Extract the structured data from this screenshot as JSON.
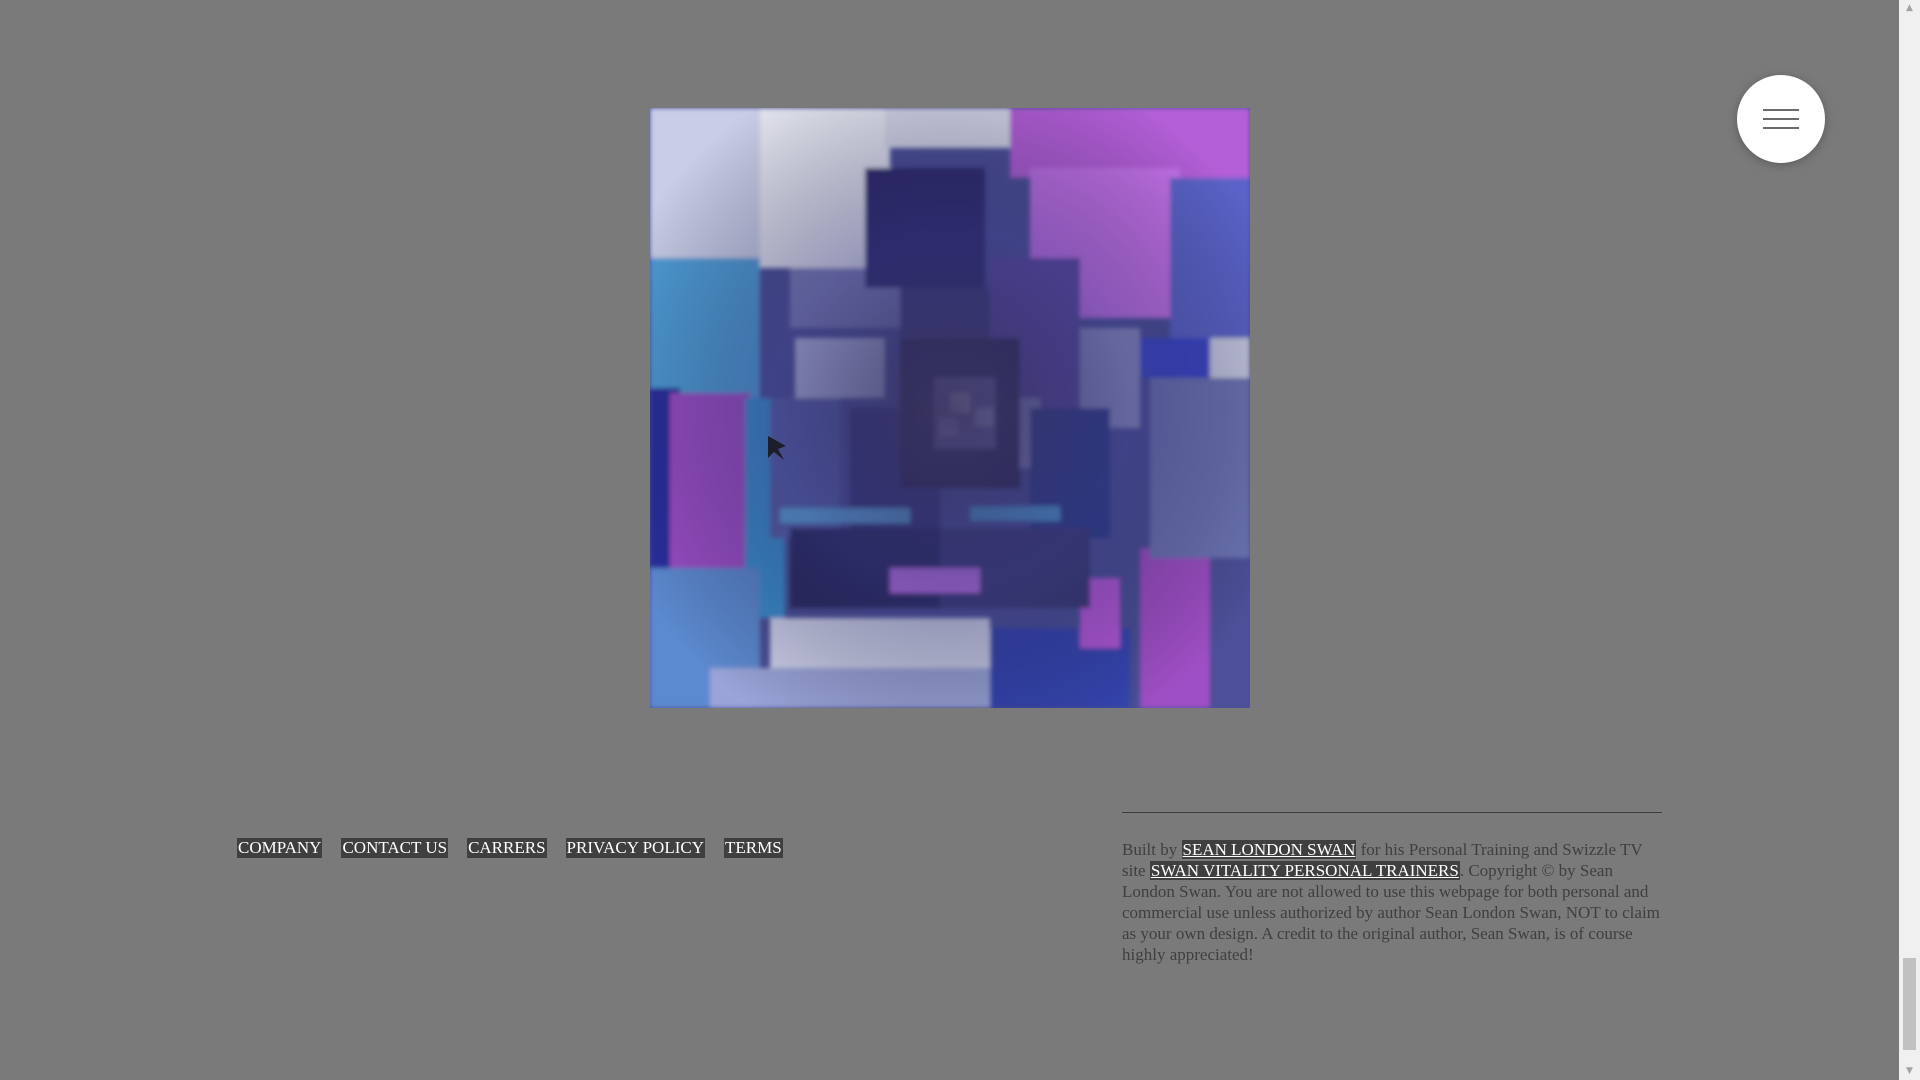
{
  "hero": {
    "image_name": "abstract-cube-tunnel-artwork"
  },
  "menu": {
    "icon": "hamburger-menu-icon"
  },
  "footer_nav": {
    "items": [
      {
        "label": "COMPANY"
      },
      {
        "label": "CONTACT US"
      },
      {
        "label": "CARRERS"
      },
      {
        "label": "PRIVACY POLICY"
      },
      {
        "label": "TERMS"
      }
    ]
  },
  "credits": {
    "prefix": "Built by ",
    "author_link": "SEAN LONDON SWAN",
    "middle": " for his Personal Training and Swizzle TV site ",
    "site_link": "SWAN VITALITY PERSONAL TRAINERS",
    "suffix": ". Copyright © by Sean London Swan. You are not allowed to use this webpage for both personal and commercial use unless authorized by author Sean London Swan, NOT to claim as your own design. A credit to the original author, Sean Swan, is of course highly appreciated!"
  },
  "scrollbar": {
    "up_icon": "scroll-up-arrow-icon",
    "down_icon": "scroll-down-arrow-icon"
  }
}
